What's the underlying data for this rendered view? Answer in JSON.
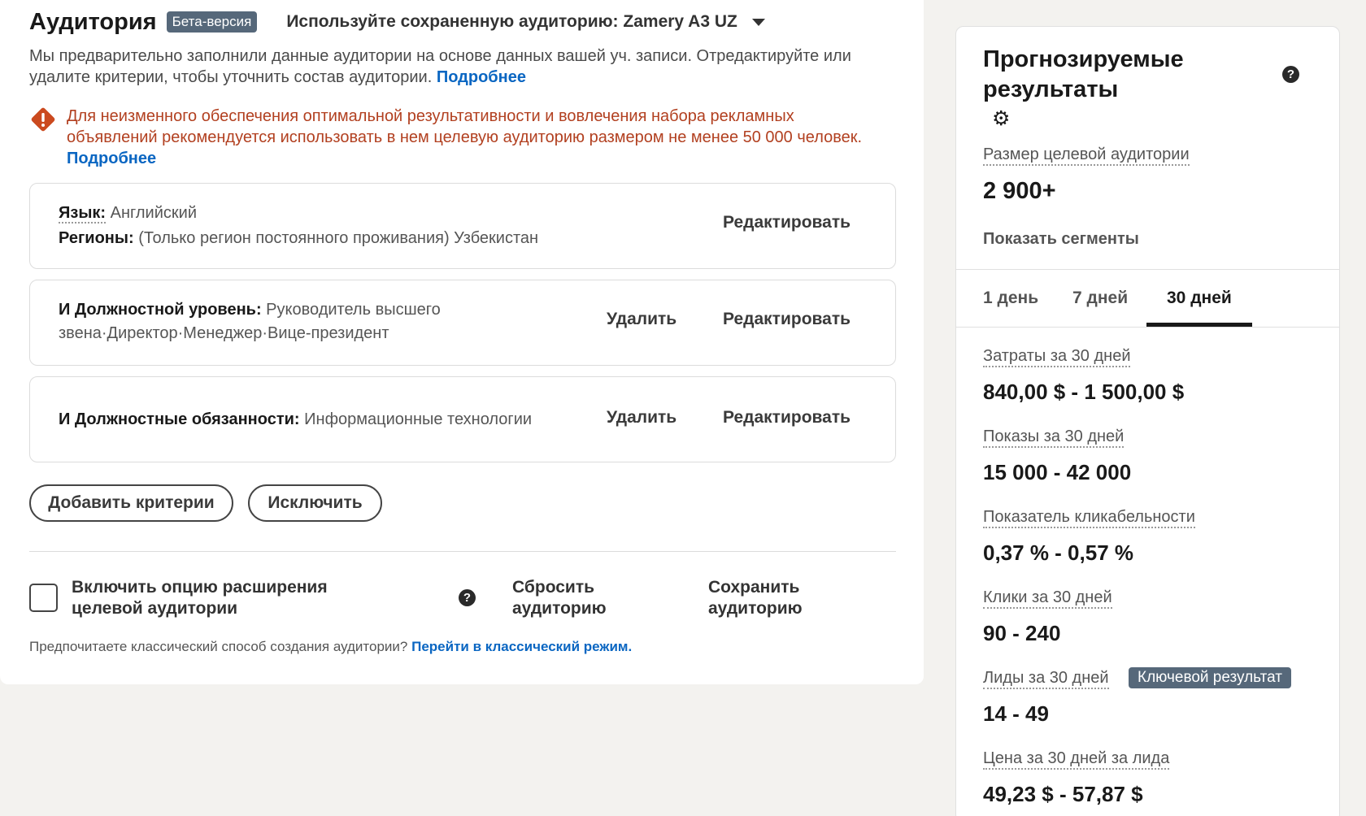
{
  "audience": {
    "title": "Аудитория",
    "beta_badge": "Бета-версия",
    "saved_audience_label": "Используйте сохраненную аудиторию: Zamery A3 UZ",
    "intro_text": "Мы предварительно заполнили данные аудитории на основе данных вашей уч. записи. Отредактируйте или удалите критерии, чтобы уточнить состав аудитории.",
    "intro_link": "Подробнее",
    "warning_text": "Для неизменного обеспечения оптимальной результативности и вовлечения набора рекламных объявлений рекомендуется использовать в нем целевую аудиторию размером не менее 50 000 человек.",
    "warning_link": "Подробнее"
  },
  "criteria": [
    {
      "language_key": "Язык:",
      "language_value": "Английский",
      "regions_key": "Регионы:",
      "regions_value": "(Только регион постоянного проживания) Узбекистан",
      "edit_label": "Редактировать"
    },
    {
      "key": "И Должностной уровень:",
      "value_line1": "Руководитель высшего",
      "value_line2": "звена·Директор·Менеджер·Вице-президент",
      "delete_label": "Удалить",
      "edit_label": "Редактировать"
    },
    {
      "key": "И Должностные обязанности:",
      "value": "Информационные технологии",
      "delete_label": "Удалить",
      "edit_label": "Редактировать"
    }
  ],
  "actions": {
    "add_criteria": "Добавить критерии",
    "exclude": "Исключить",
    "expansion_line1": "Включить опцию расширения",
    "expansion_line2": "целевой аудитории",
    "reset_line1": "Сбросить",
    "reset_line2": "аудиторию",
    "save_line1": "Сохранить",
    "save_line2": "аудиторию",
    "classic_text": "Предпочитаете классический способ создания аудитории?",
    "classic_link": "Перейти в классический режим."
  },
  "forecast": {
    "title": "Прогнозируемые результаты",
    "audience_size_label": "Размер целевой аудитории",
    "audience_size_value": "2 900+",
    "show_segments": "Показать сегменты",
    "tabs": [
      "1 день",
      "7 дней",
      "30 дней"
    ],
    "active_tab": "30 дней",
    "metrics": [
      {
        "label": "Затраты за 30 дней",
        "value": "840,00 $ - 1 500,00 $"
      },
      {
        "label": "Показы за 30 дней",
        "value": "15 000 - 42 000"
      },
      {
        "label": "Показатель кликабельности",
        "value": "0,37 % - 0,57 %"
      },
      {
        "label": "Клики за 30 дней",
        "value": "90 - 240"
      },
      {
        "label": "Лиды за 30 дней",
        "value": "14 - 49",
        "badge": "Ключевой результат"
      },
      {
        "label": "Цена за 30 дней за лида",
        "value": "49,23 $ - 57,87 $"
      }
    ]
  },
  "icons": {
    "warning": "warning-diamond-icon",
    "help": "question-circle-icon",
    "settings": "gear-icon",
    "dropdown": "caret-down-icon"
  },
  "colors": {
    "link": "#0a66c2",
    "warning": "#b24020",
    "badge": "#56687a"
  }
}
